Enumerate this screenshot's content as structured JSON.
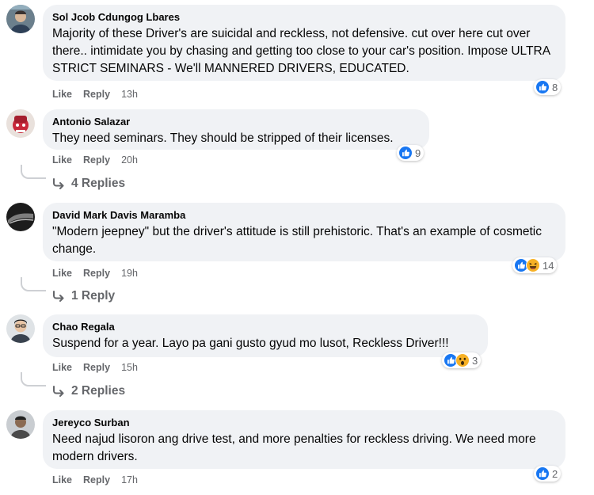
{
  "colors": {
    "like_blue": "#1877f2",
    "haha_yellow": "#f7b125",
    "bubble_bg": "#f0f2f5",
    "meta_gray": "#65676b"
  },
  "actions": {
    "like": "Like",
    "reply": "Reply"
  },
  "comments": [
    {
      "author": "Sol Jcob Cdungog Lbares",
      "text": "Majority of these Driver's are suicidal and reckless, not defensive. cut over here cut over there.. intimidate you by chasing and getting too close to your car's position. Impose ULTRA STRICT SEMINARS - We'll MANNERED DRIVERS, EDUCATED.",
      "time": "13h",
      "reaction_icons": [
        "like-icon"
      ],
      "reaction_count": "8",
      "replies_label": ""
    },
    {
      "author": "Antonio Salazar",
      "text": "They need seminars. They should be stripped of their licenses.",
      "time": "20h",
      "reaction_icons": [
        "like-icon"
      ],
      "reaction_count": "9",
      "replies_label": "4 Replies"
    },
    {
      "author": "David Mark Davis Maramba",
      "text": "\"Modern jeepney\" but the driver's attitude is still prehistoric. That's an example of cosmetic change.",
      "time": "19h",
      "reaction_icons": [
        "like-icon",
        "haha-icon"
      ],
      "reaction_count": "14",
      "replies_label": "1 Reply"
    },
    {
      "author": "Chao Regala",
      "text": "Suspend for a year. Layo pa gani gusto gyud mo lusot, Reckless Driver!!!",
      "time": "15h",
      "reaction_icons": [
        "like-icon",
        "wow-icon"
      ],
      "reaction_count": "3",
      "replies_label": "2 Replies"
    },
    {
      "author": "Jereyco Surban",
      "text": "Need najud lisoron ang drive test, and more penalties for reckless driving. We need more modern drivers.",
      "time": "17h",
      "reaction_icons": [
        "like-icon"
      ],
      "reaction_count": "2",
      "replies_label": ""
    }
  ]
}
